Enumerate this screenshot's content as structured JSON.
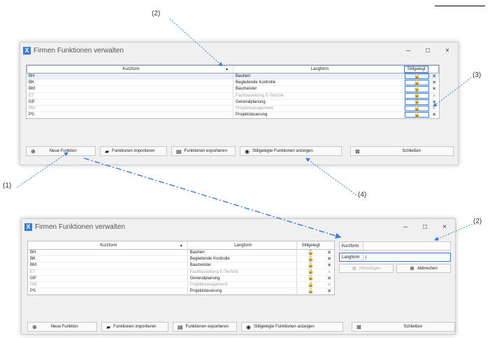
{
  "window_title": "Firmen Funktionen verwalten",
  "window_controls": {
    "minimize": "–",
    "maximize": "□",
    "close": "×"
  },
  "table_headers": {
    "kurzform": "Kurzform",
    "langform": "Langform",
    "stillgelegt": "Stillgelegt"
  },
  "rows": [
    {
      "kurz": "BH",
      "lang": "Bauherr",
      "inactive": false
    },
    {
      "kurz": "BK",
      "lang": "Begleitende Kontrolle",
      "inactive": false
    },
    {
      "kurz": "BM",
      "lang": "Baumeister",
      "inactive": false
    },
    {
      "kurz": "ET",
      "lang": "Fachbauleitung E-Technik",
      "inactive": true
    },
    {
      "kurz": "GP",
      "lang": "Generalplanung",
      "inactive": false
    },
    {
      "kurz": "PM",
      "lang": "Projektmanagement",
      "inactive": true
    },
    {
      "kurz": "PS",
      "lang": "Projektsteuerung",
      "inactive": false
    }
  ],
  "icons": {
    "unlocked": "🔓",
    "locked": "🔒",
    "delete": "✕"
  },
  "buttons": {
    "neue_funktion": "Neue Funktion",
    "importieren": "Funktionen importieren",
    "exportieren": "Funktionen exportieren",
    "stillgelegte": "Stillgelegte Funktionen anzeigen",
    "schliessen": "Schließen"
  },
  "side_panel": {
    "kurzform_label": "Kurzform",
    "langform_label": "Langform",
    "hinzufuegen": "Hinzufügen",
    "abbrechen": "Abbrechen"
  },
  "annotations": {
    "a1": "(1)",
    "a2": "(2)",
    "a3": "(3)",
    "a4": "(4)"
  },
  "colors": {
    "accent": "#3a7bd5",
    "arrow": "#3a7bd5"
  }
}
